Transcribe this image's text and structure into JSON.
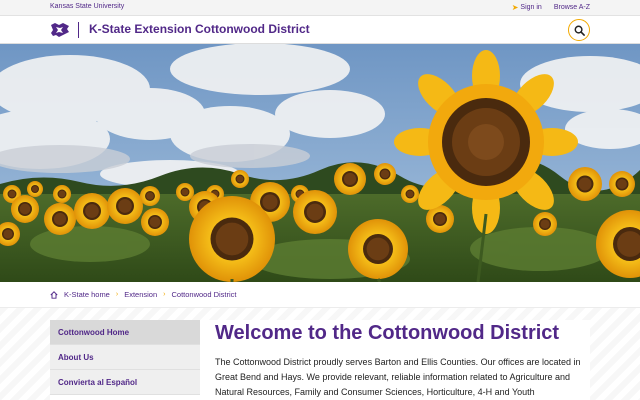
{
  "topbar": {
    "university": "Kansas State University",
    "signin_label": "Sign in",
    "browse_label": "Browse A-Z"
  },
  "header": {
    "site_title": "K-State Extension Cottonwood District"
  },
  "hero": {
    "image": "sunflower-field-photo"
  },
  "breadcrumb": {
    "items": [
      "K-State home",
      "Extension",
      "Cottonwood District"
    ]
  },
  "sidenav": {
    "items": [
      "Cottonwood Home",
      "About Us",
      "Convierta al Español"
    ]
  },
  "main": {
    "title": "Welcome to the Cottonwood District",
    "intro": "The Cottonwood District proudly serves Barton and Ellis Counties. Our offices are located in Great Bend and Hays. We provide relevant, reliable information related to Agriculture and Natural Resources, Family and Consumer Sciences, Horticulture, 4-H and Youth"
  },
  "colors": {
    "primary": "#512888",
    "accent": "#f2a900"
  }
}
